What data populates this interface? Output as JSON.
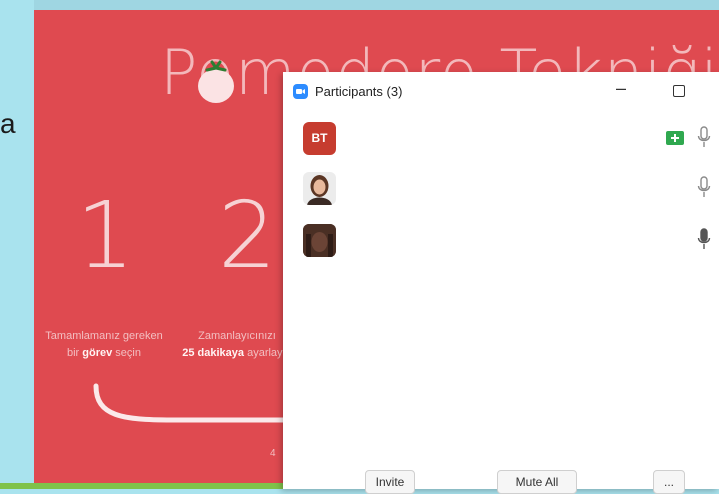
{
  "background": {
    "partial_letter": "a"
  },
  "slide": {
    "title": "Pomodoro Tekniği",
    "step1": {
      "number": "1",
      "line1": "Tamamlamanız gereken",
      "line2_pre": "bir ",
      "line2_bold": "görev",
      "line2_post": " seçin"
    },
    "step2": {
      "number": "2",
      "line1": "Zamanlayıcınızı",
      "line2_bold": "25 dakikaya",
      "line2_post": " ayarlayın"
    },
    "small_text": "4"
  },
  "participants": {
    "title": "Participants (3)",
    "items": [
      {
        "initials": "BT",
        "video": "on",
        "mic": "muted"
      },
      {
        "initials": "",
        "video": "off",
        "mic": "muted"
      },
      {
        "initials": "",
        "video": "off",
        "mic": "active"
      }
    ],
    "invite_label": "Invite",
    "mute_all_label": "Mute All",
    "more_label": "..."
  },
  "colors": {
    "slide_bg": "#df4a50",
    "outer_bg": "#a9e3ee",
    "initials_avatar": "#c63c2f",
    "video_on": "#2fa84f",
    "zoom_blue": "#2d8cff"
  }
}
